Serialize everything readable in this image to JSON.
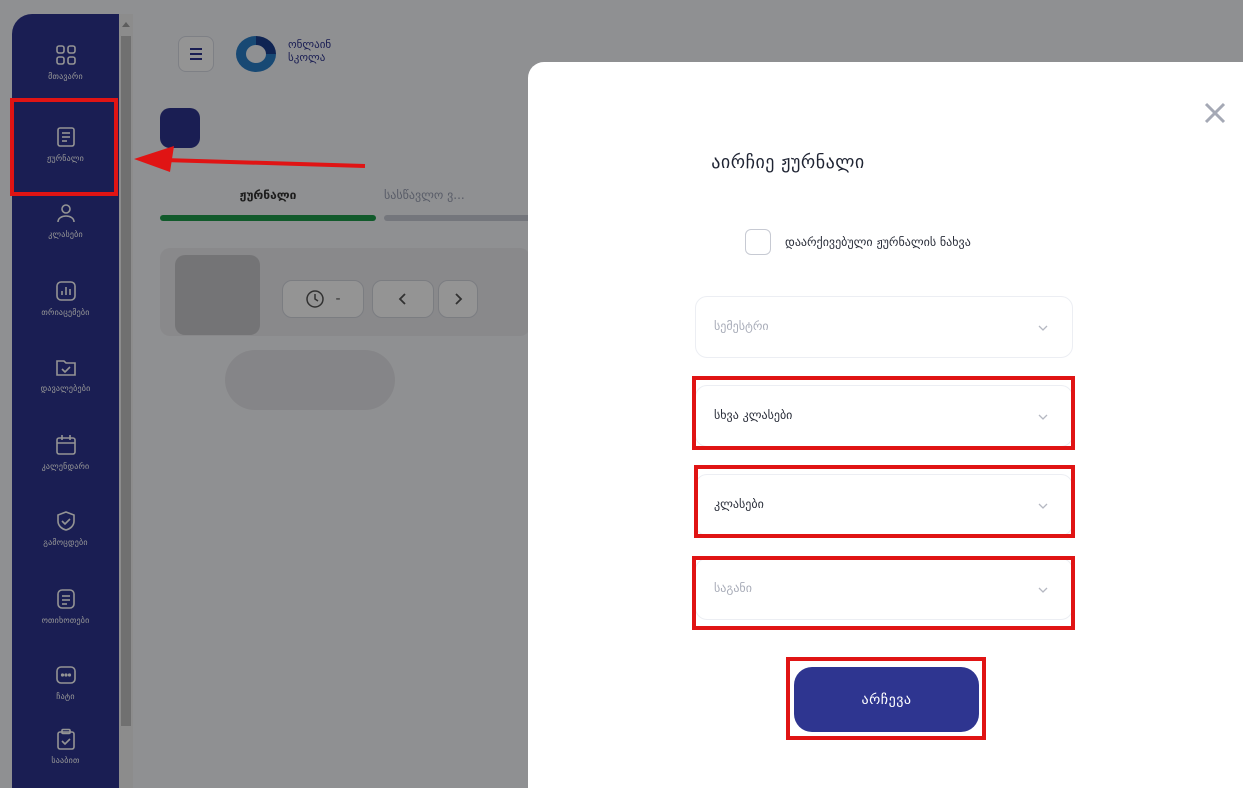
{
  "header": {
    "logo_text_line1": "ონლაინ",
    "logo_text_line2": "სკოლა"
  },
  "sidebar": {
    "items": [
      {
        "label": "მთავარი",
        "icon": "grid-icon"
      },
      {
        "label": "ჟურნალი",
        "icon": "journal-icon"
      },
      {
        "label": "კლასები",
        "icon": "users-icon"
      },
      {
        "label": "თრიაცემები",
        "icon": "chart-icon"
      },
      {
        "label": "დავალებები",
        "icon": "folder-check-icon"
      },
      {
        "label": "კალენდარი",
        "icon": "calendar-icon"
      },
      {
        "label": "გამოცდები",
        "icon": "shield-check-icon"
      },
      {
        "label": "ოთიხოთები",
        "icon": "list-icon"
      },
      {
        "label": "ჩატი",
        "icon": "chat-icon"
      },
      {
        "label": "სააბით",
        "icon": "clipboard-icon"
      }
    ]
  },
  "main": {
    "tabs": [
      {
        "label": "ჟურნალი"
      },
      {
        "label": "სასწავლო ვ..."
      }
    ],
    "time_button": "-"
  },
  "modal": {
    "title": "აირჩიე ჟურნალი",
    "archived_checkbox_label": "დაარქივებული ჟურნალის ნახვა",
    "archived_checked": false,
    "selects": {
      "semester": "სემესტრი",
      "other_classes": "სხვა კლასები",
      "classes": "კლასები",
      "subject": "საგანი"
    },
    "submit_label": "არჩევა"
  },
  "colors": {
    "brand": "#2e3590",
    "highlight": "#e01414",
    "accent_green": "#1e9c4a"
  }
}
